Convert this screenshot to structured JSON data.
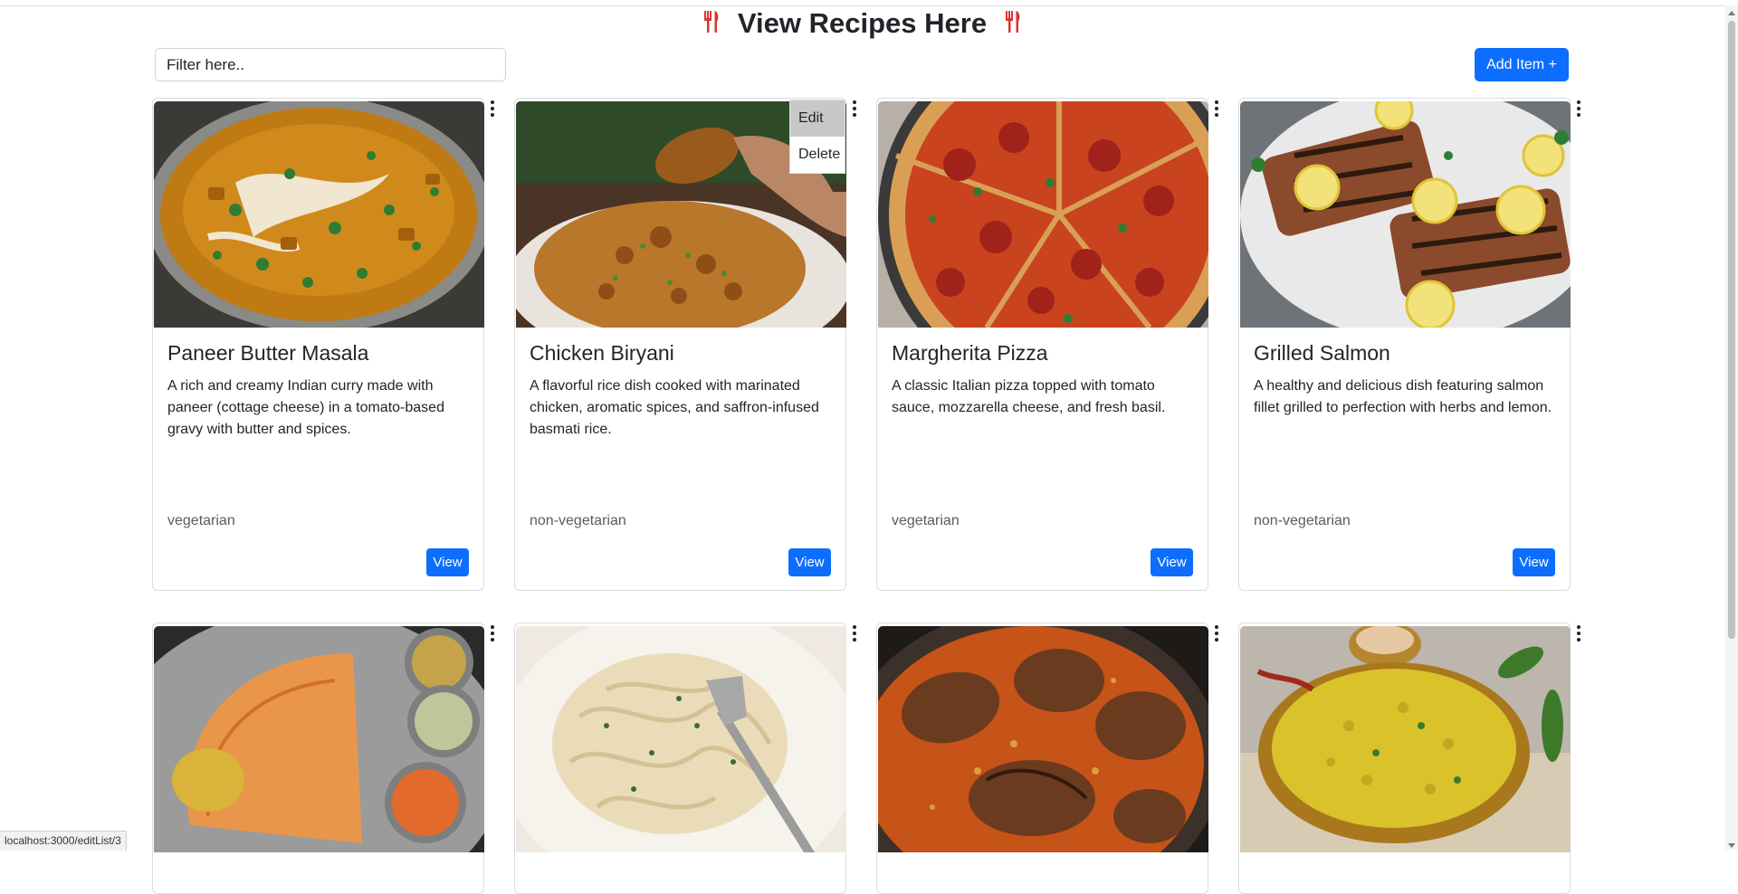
{
  "header": {
    "title": "View Recipes Here"
  },
  "toolbar": {
    "filter_placeholder": "Filter here..",
    "filter_value": "",
    "add_label": "Add Item +"
  },
  "menu": {
    "edit_label": "Edit",
    "delete_label": "Delete"
  },
  "recipes": [
    {
      "title": "Paneer Butter Masala",
      "description": "A rich and creamy Indian curry made with paneer (cottage cheese) in a tomato-based gravy with butter and spices.",
      "type": "vegetarian",
      "view_label": "View"
    },
    {
      "title": "Chicken Biryani",
      "description": "A flavorful rice dish cooked with marinated chicken, aromatic spices, and saffron-infused basmati rice.",
      "type": "non-vegetarian",
      "view_label": "View"
    },
    {
      "title": "Margherita Pizza",
      "description": "A classic Italian pizza topped with tomato sauce, mozzarella cheese, and fresh basil.",
      "type": "vegetarian",
      "view_label": "View"
    },
    {
      "title": "Grilled Salmon",
      "description": "A healthy and delicious dish featuring salmon fillet grilled to perfection with herbs and lemon.",
      "type": "non-vegetarian",
      "view_label": "View"
    },
    {
      "title": "",
      "description": "",
      "type": "",
      "view_label": ""
    },
    {
      "title": "",
      "description": "",
      "type": "",
      "view_label": ""
    },
    {
      "title": "",
      "description": "",
      "type": "",
      "view_label": ""
    },
    {
      "title": "",
      "description": "",
      "type": "",
      "view_label": ""
    }
  ],
  "statusbar": {
    "url": "localhost:3000/editList/3"
  },
  "colors": {
    "primary": "#0d6efd",
    "accent_icon": "#e03131"
  }
}
